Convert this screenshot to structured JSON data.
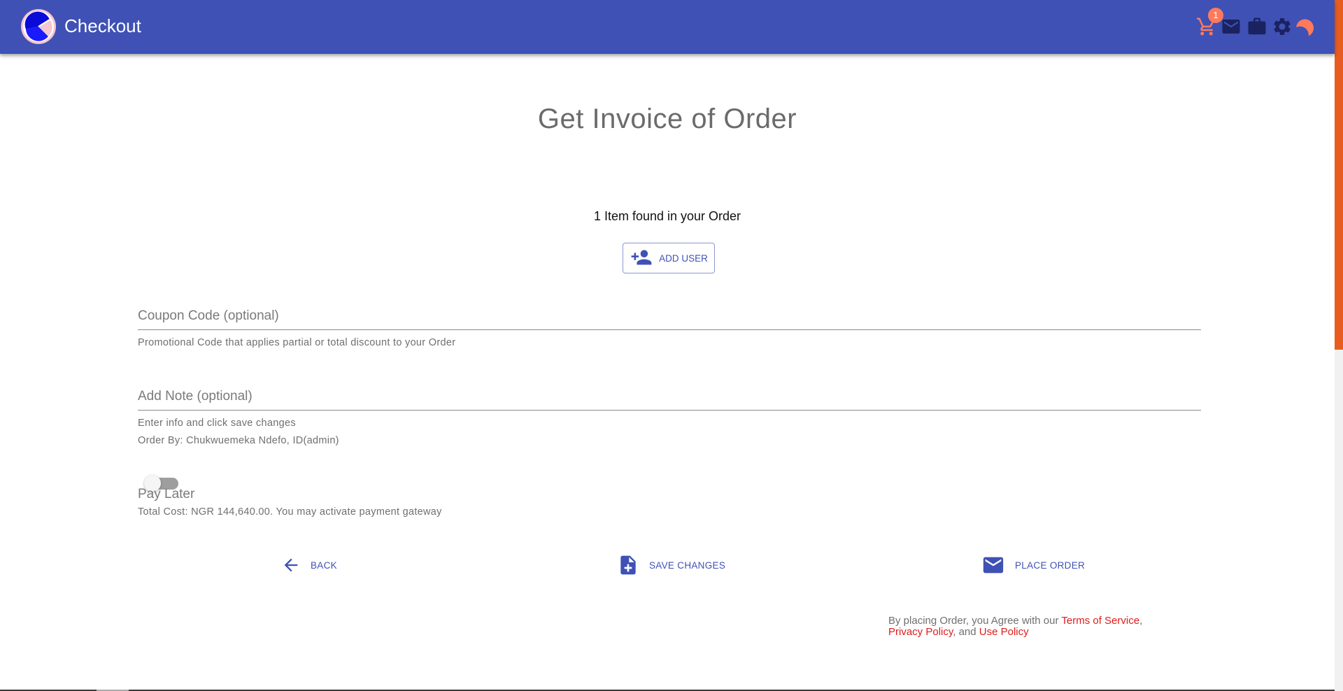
{
  "app": {
    "title": "Checkout",
    "cart_count": "1",
    "colors": {
      "primary": "#3f51b5",
      "accent": "#ff7a5c",
      "link": "#e01b1b",
      "scroll_thumb": "#e85d1f"
    }
  },
  "toolbar_icons": [
    "cart-icon",
    "mail-icon",
    "briefcase-icon",
    "gear-icon",
    "moon-icon"
  ],
  "main": {
    "title": "Get Invoice of Order",
    "items_found": "1 Item found in your Order",
    "add_user_label": "ADD USER",
    "coupon": {
      "label": "Coupon Code (optional)",
      "helper": "Promotional Code that applies partial or total discount to your Order"
    },
    "note": {
      "label": "Add Note (optional)",
      "helper": "Enter info and click save changes",
      "order_by": "Order By: Chukwuemeka Ndefo, ID(admin)"
    },
    "pay_later": {
      "label": "Pay Later",
      "checked": false,
      "total_cost": "Total Cost: NGR 144,640.00. You may activate payment gateway"
    },
    "actions": {
      "back": "BACK",
      "save": "SAVE CHANGES",
      "place_order": "PLACE ORDER"
    },
    "terms": {
      "prefix": "By placing Order, you Agree with our ",
      "terms_of_service": "Terms of Service",
      "comma": ",",
      "privacy_policy": "Privacy Policy",
      "and_text": ", and ",
      "use_policy": "Use Policy"
    }
  }
}
